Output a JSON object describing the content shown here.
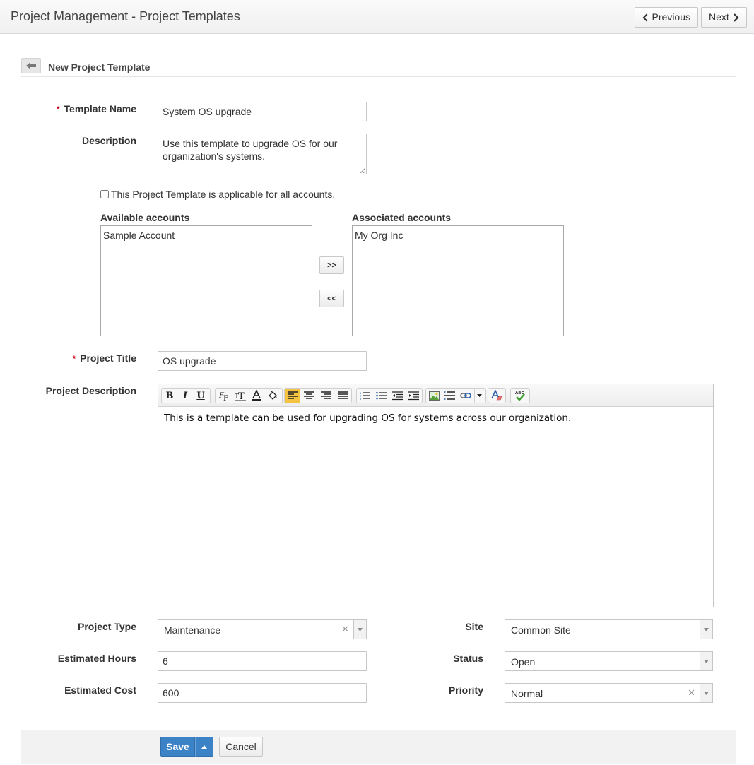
{
  "header": {
    "title": "Project Management - Project Templates",
    "prev_label": "Previous",
    "next_label": "Next"
  },
  "section": {
    "title": "New Project Template"
  },
  "form": {
    "template_name": {
      "label": "Template Name",
      "value": "System OS upgrade"
    },
    "description": {
      "label": "Description",
      "value": "Use this template to upgrade OS for our organization's systems."
    },
    "all_accounts_label": "This Project Template is applicable for all accounts.",
    "all_accounts_checked": false,
    "available_accounts": {
      "label": "Available accounts",
      "items": [
        "Sample Account"
      ]
    },
    "associated_accounts": {
      "label": "Associated accounts",
      "items": [
        "My Org Inc"
      ]
    },
    "move_right_label": ">>",
    "move_left_label": "<<",
    "project_title": {
      "label": "Project Title",
      "value": "OS upgrade"
    },
    "project_description": {
      "label": "Project Description",
      "value": "This is a template can be used for upgrading OS for systems across our organization."
    },
    "project_type": {
      "label": "Project Type",
      "value": "Maintenance"
    },
    "site": {
      "label": "Site",
      "value": "Common Site"
    },
    "estimated_hours": {
      "label": "Estimated Hours",
      "value": "6"
    },
    "status": {
      "label": "Status",
      "value": "Open"
    },
    "estimated_cost": {
      "label": "Estimated Cost",
      "value": "600"
    },
    "priority": {
      "label": "Priority",
      "value": "Normal"
    }
  },
  "editor_toolbar": {
    "bold": "B",
    "italic": "I",
    "underline": "U",
    "active_button": "align-left",
    "active_color": "#f5c342"
  },
  "footer": {
    "save_label": "Save",
    "cancel_label": "Cancel"
  },
  "colors": {
    "primary_button": "#3b82c6",
    "required_marker": "#d0021b"
  }
}
